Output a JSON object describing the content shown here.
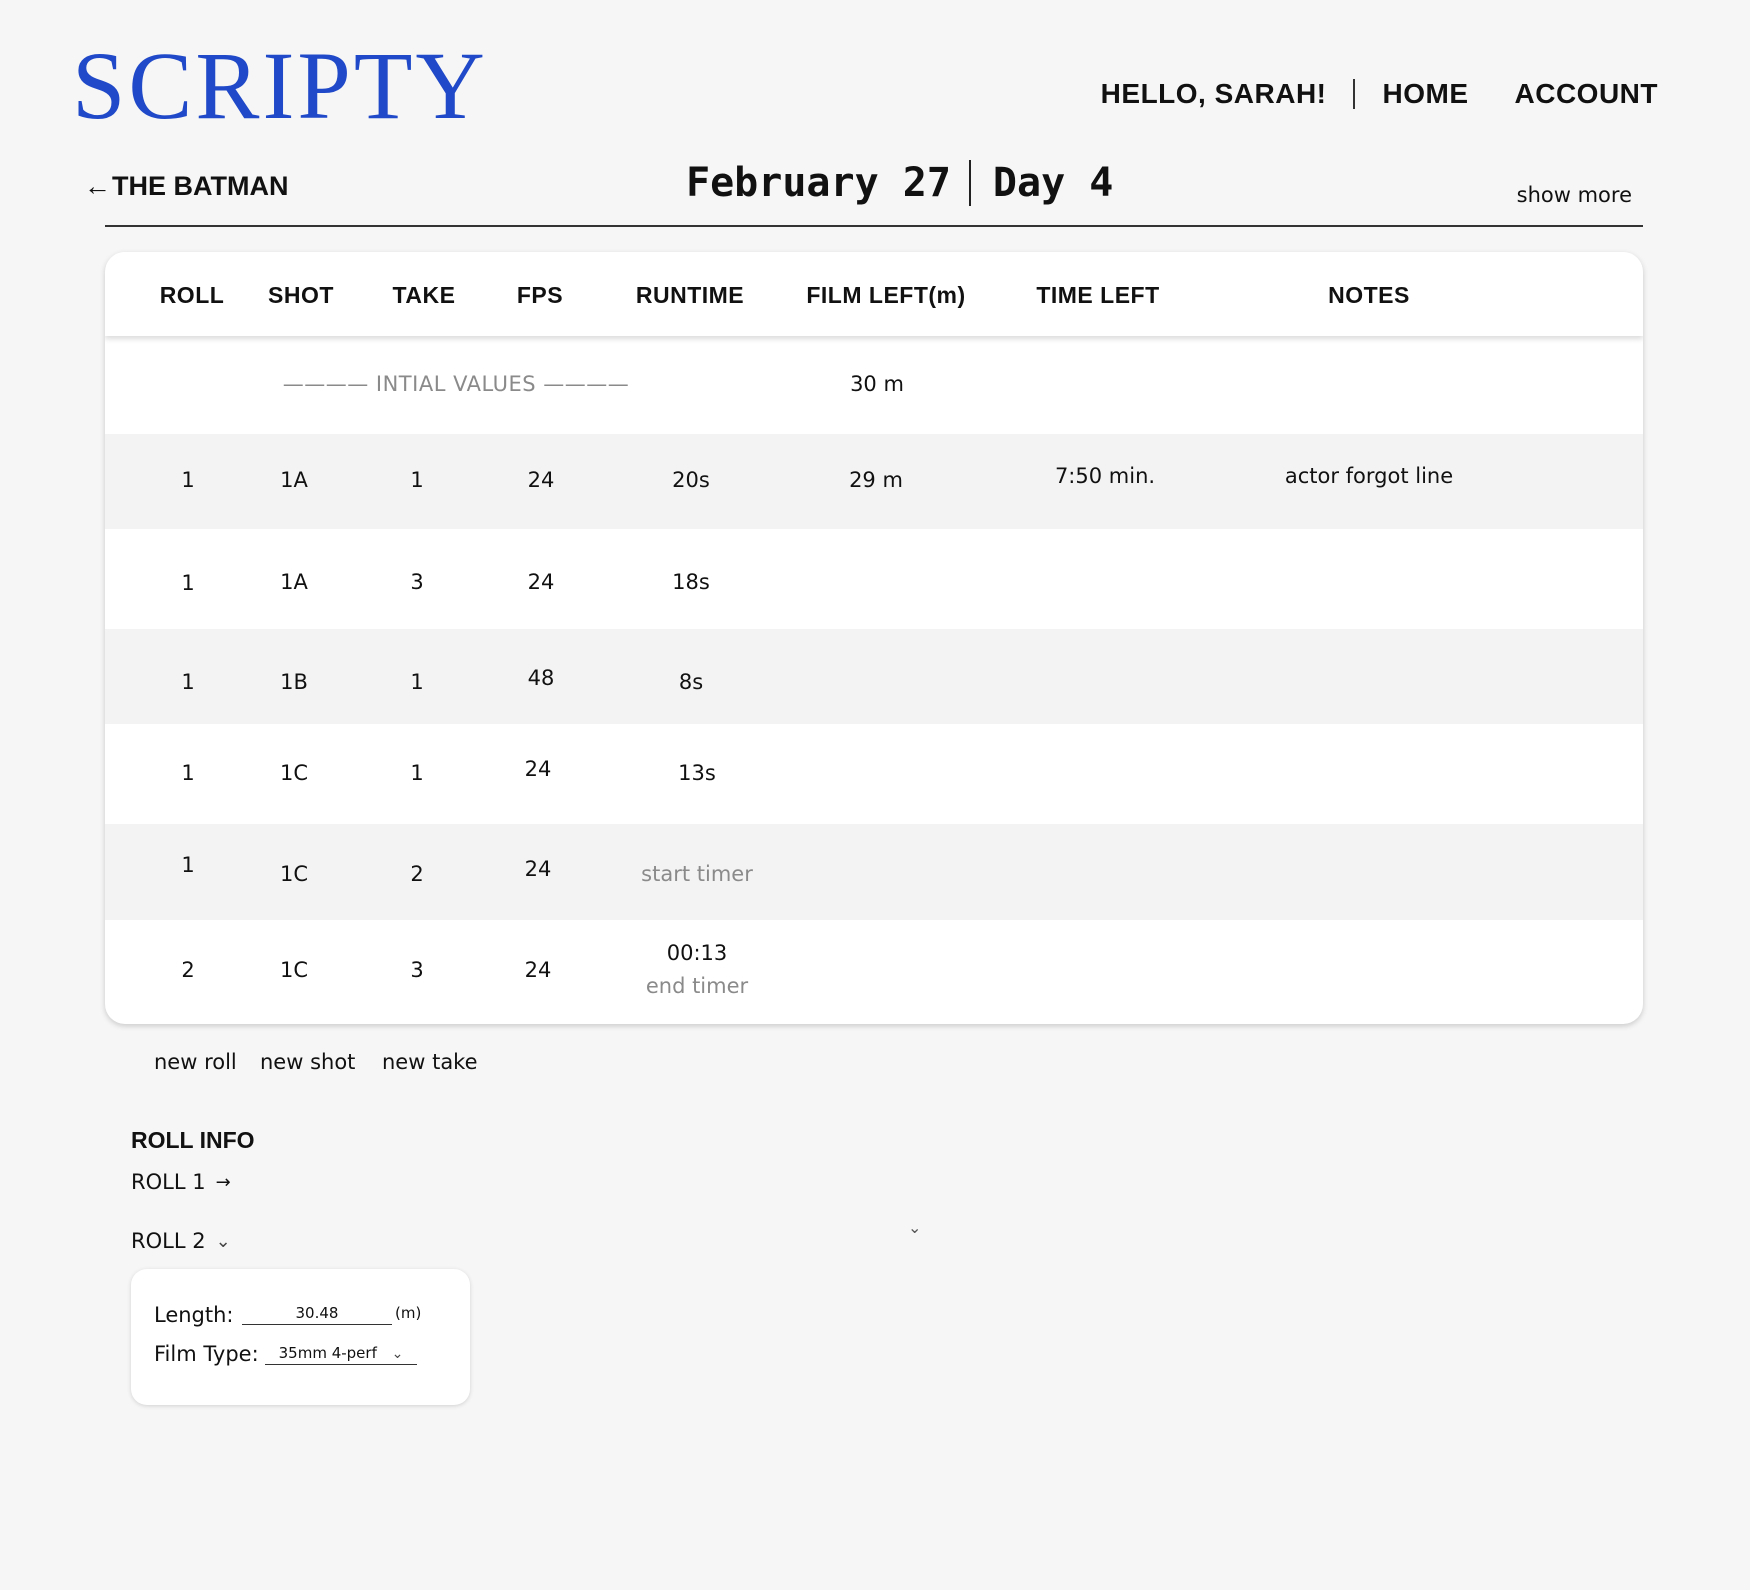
{
  "app": {
    "logo": "SCRIPTY"
  },
  "nav": {
    "greeting": "HELLO, SARAH!",
    "home": "HOME",
    "account": "ACCOUNT"
  },
  "header": {
    "back_arrow": "←",
    "project": "THE BATMAN",
    "date": "February 27",
    "day": "Day 4",
    "show_more": "show more"
  },
  "table": {
    "columns": [
      "ROLL",
      "SHOT",
      "TAKE",
      "FPS",
      "RUNTIME",
      "FILM LEFT(m)",
      "TIME LEFT",
      "NOTES"
    ],
    "initial": {
      "label": "———— INTIAL VALUES ————",
      "film_left": "30 m"
    },
    "rows": [
      {
        "roll": "1",
        "shot": "1A",
        "take": "1",
        "fps": "24",
        "runtime": "20s",
        "film_left": "29 m",
        "time_left": "7:50 min.",
        "notes": "actor forgot line"
      },
      {
        "roll": "1",
        "shot": "1A",
        "take": "3",
        "fps": "24",
        "runtime": "18s"
      },
      {
        "roll": "1",
        "shot": "1B",
        "take": "1",
        "fps": "48",
        "runtime": "8s"
      },
      {
        "roll": "1",
        "shot": "1C",
        "take": "1",
        "fps": "24",
        "runtime": "13s"
      },
      {
        "roll": "1",
        "shot": "1C",
        "take": "2",
        "fps": "24",
        "runtime": "start timer"
      },
      {
        "roll": "2",
        "shot": "1C",
        "take": "3",
        "fps": "24",
        "runtime": "00:13",
        "runtime_action": "end timer"
      }
    ]
  },
  "actions": {
    "new_roll": "new roll",
    "new_shot": "new shot",
    "new_take": "new take"
  },
  "roll_info": {
    "title": "ROLL INFO",
    "roll1": {
      "label": "ROLL 1",
      "indicator": "→"
    },
    "roll2": {
      "label": "ROLL 2",
      "indicator": "⌄"
    },
    "length_label": "Length:",
    "length_value": "30.48",
    "length_unit": "(m)",
    "film_type_label": "Film Type:",
    "film_type_value": "35mm 4-perf"
  },
  "colors": {
    "brand": "#1f49c8",
    "background": "#f6f6f6",
    "muted": "#8a8a8a"
  },
  "icons": {
    "back": "left-arrow-icon",
    "expand": "chevron-down-icon",
    "collapsed": "right-arrow-icon"
  }
}
